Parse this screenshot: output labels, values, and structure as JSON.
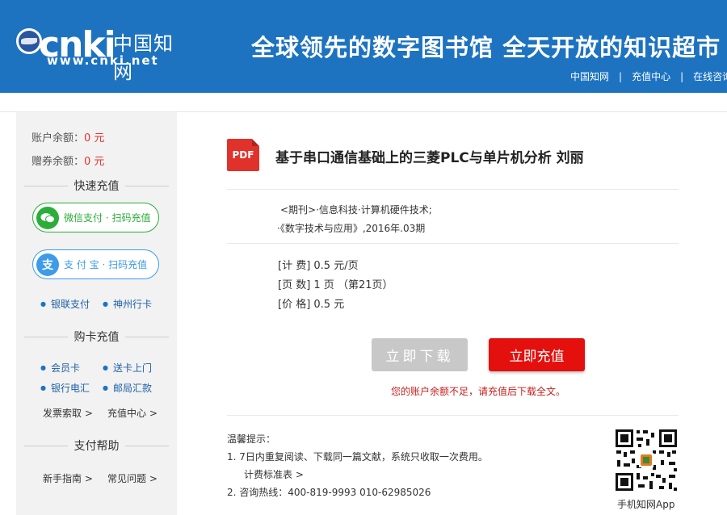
{
  "header": {
    "logo_text": "cnki",
    "logo_cn": "中国知网",
    "logo_url": "www.cnki.net",
    "slogan": "全球领先的数字图书馆  全天开放的知识超市",
    "links": [
      "中国知网",
      "充值中心",
      "在线咨询"
    ],
    "bg_color": "#1d73c0"
  },
  "sidebar": {
    "balance_label": "账户余额：",
    "balance_value": "0 元",
    "coupon_label": "赠券余额：",
    "coupon_value": "0 元",
    "quick_charge_title": "快速充值",
    "wechat_btn": "微信支付 · 扫码充值",
    "alipay_btn": "支 付 宝 · 扫码充值",
    "alipay_icon_text": "支",
    "links_quick": [
      "银联支付",
      "神州行卡"
    ],
    "card_title": "购卡充值",
    "links_card": [
      "会员卡",
      "送卡上门",
      "银行电汇",
      "邮局汇款"
    ],
    "links_card_more": [
      "发票索取 >",
      "充值中心 >"
    ],
    "help_title": "支付帮助",
    "links_help": [
      "新手指南 >",
      "常见问题 >"
    ]
  },
  "main": {
    "pdf_icon": "PDF",
    "title": "基于串口通信基础上的三菱PLC与单片机分析 刘丽",
    "meta_line1": "<期刊>·信息科技·计算机硬件技术;",
    "meta_line2": "·《数字技术与应用》,2016年.03期",
    "price_lines": [
      "[计 费] 0.5 元/页",
      "[页 数] 1 页 （第21页）",
      "[价 格] 0.5 元"
    ],
    "download_btn": "立即下载",
    "charge_btn": "立即充值",
    "warning": "您的账户余额不足，请充值后下载全文。",
    "tips_title": "温馨提示：",
    "tip1": "1.  7日内重复阅读、下载同一篇文献，系统只收取一次费用。",
    "tip1_link": "计费标准表 >",
    "tip2": "2.  咨询热线：400-819-9993    010-62985026",
    "qr_label": "手机知网App"
  }
}
